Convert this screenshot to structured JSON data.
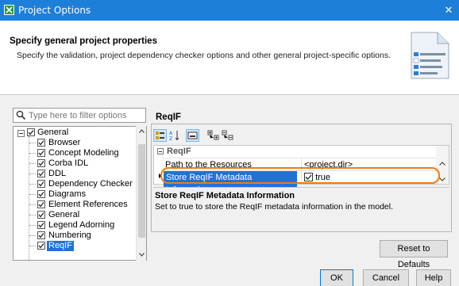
{
  "window": {
    "title": "Project Options",
    "close_glyph": "✕"
  },
  "header": {
    "title": "Specify general project properties",
    "description": "Specify the validation, project dependency checker options and other general project-specific options."
  },
  "filter": {
    "placeholder": "Type here to filter options"
  },
  "tree": {
    "items": [
      {
        "label": "General",
        "level": 0,
        "expanded": true,
        "checked": true
      },
      {
        "label": "Browser",
        "level": 1,
        "checked": true
      },
      {
        "label": "Concept Modeling",
        "level": 1,
        "checked": true
      },
      {
        "label": "Corba IDL",
        "level": 1,
        "checked": true
      },
      {
        "label": "DDL",
        "level": 1,
        "checked": true
      },
      {
        "label": "Dependency Checker",
        "level": 1,
        "checked": true
      },
      {
        "label": "Diagrams",
        "level": 1,
        "checked": true
      },
      {
        "label": "Element References",
        "level": 1,
        "checked": true
      },
      {
        "label": "General",
        "level": 1,
        "checked": true
      },
      {
        "label": "Legend Adorning",
        "level": 1,
        "checked": true
      },
      {
        "label": "Numbering",
        "level": 1,
        "checked": true
      },
      {
        "label": "ReqIF",
        "level": 1,
        "checked": true,
        "selected": true
      }
    ]
  },
  "panel": {
    "section_title": "ReqIF",
    "toolbar": [
      "categorized-view-icon",
      "alphabetical-sort-icon",
      "description-toggle-icon",
      "expand-all-icon",
      "collapse-all-icon"
    ],
    "group_label": "ReqIF",
    "rows": [
      {
        "name": "Path to the Resources",
        "value": "<project.dir>"
      },
      {
        "name": "Store ReqIF Metadata Information",
        "value": "true",
        "checkbox": true,
        "checked": true,
        "selected": true
      }
    ],
    "description_title": "Store ReqIF Metadata Information",
    "description_text": "Set to true to store the ReqIF metadata information in the model."
  },
  "buttons": {
    "reset": "Reset to Defaults",
    "ok": "OK",
    "cancel": "Cancel",
    "help": "Help"
  },
  "colors": {
    "titlebar": "#1d7fd8",
    "selection": "#1e73d6",
    "highlight": "#f07a14"
  }
}
